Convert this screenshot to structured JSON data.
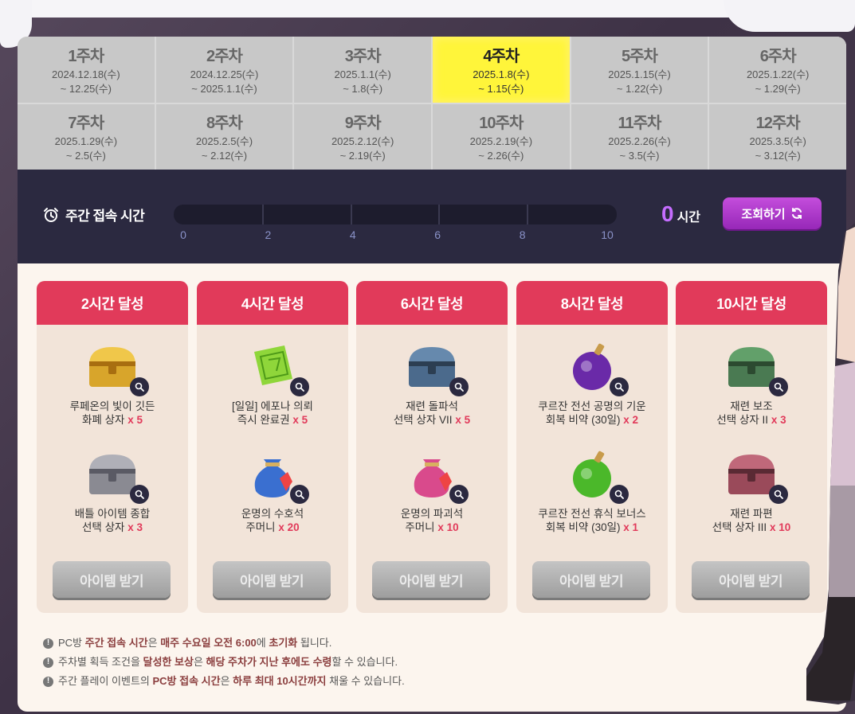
{
  "weeks": [
    {
      "title": "1주차",
      "start": "2024.12.18(수)",
      "end": "~ 12.25(수)"
    },
    {
      "title": "2주차",
      "start": "2024.12.25(수)",
      "end": "~ 2025.1.1(수)"
    },
    {
      "title": "3주차",
      "start": "2025.1.1(수)",
      "end": "~ 1.8(수)"
    },
    {
      "title": "4주차",
      "start": "2025.1.8(수)",
      "end": "~ 1.15(수)"
    },
    {
      "title": "5주차",
      "start": "2025.1.15(수)",
      "end": "~ 1.22(수)"
    },
    {
      "title": "6주차",
      "start": "2025.1.22(수)",
      "end": "~ 1.29(수)"
    },
    {
      "title": "7주차",
      "start": "2025.1.29(수)",
      "end": "~ 2.5(수)"
    },
    {
      "title": "8주차",
      "start": "2025.2.5(수)",
      "end": "~ 2.12(수)"
    },
    {
      "title": "9주차",
      "start": "2025.2.12(수)",
      "end": "~ 2.19(수)"
    },
    {
      "title": "10주차",
      "start": "2025.2.19(수)",
      "end": "~ 2.26(수)"
    },
    {
      "title": "11주차",
      "start": "2025.2.26(수)",
      "end": "~ 3.5(수)"
    },
    {
      "title": "12주차",
      "start": "2025.3.5(수)",
      "end": "~ 3.12(수)"
    }
  ],
  "active_week": 4,
  "timebar": {
    "label": "주간 접속 시간",
    "ticks": [
      "0",
      "2",
      "4",
      "6",
      "8",
      "10"
    ],
    "progress_hours": 0,
    "hours_value": "0",
    "hours_unit": "시간",
    "refresh_label": "조회하기"
  },
  "rewards": [
    {
      "title": "2시간 달성",
      "items": [
        {
          "icon": "golden-chest-icon",
          "name1": "루페온의 빛이 깃든",
          "name2": "화폐 상자",
          "qty": "x 5"
        },
        {
          "icon": "battle-item-chest-icon",
          "name1": "배틀 아이템 종합",
          "name2": "선택 상자",
          "qty": "x 3"
        }
      ],
      "button": "아이템 받기"
    },
    {
      "title": "4시간 달성",
      "items": [
        {
          "icon": "green-scroll-icon",
          "name1": "[일일] 에포나 의뢰",
          "name2": "즉시 완료권",
          "qty": "x 5"
        },
        {
          "icon": "blue-pouch-icon",
          "name1": "운명의 수호석",
          "name2": "주머니",
          "qty": "x 20"
        }
      ],
      "button": "아이템 받기"
    },
    {
      "title": "6시간 달성",
      "items": [
        {
          "icon": "blue-chest-icon",
          "name1": "재련 돌파석",
          "name2": "선택 상자 VII",
          "qty": "x 5"
        },
        {
          "icon": "pink-pouch-icon",
          "name1": "운명의 파괴석",
          "name2": "주머니",
          "qty": "x 10"
        }
      ],
      "button": "아이템 받기"
    },
    {
      "title": "8시간 달성",
      "items": [
        {
          "icon": "purple-potion-icon",
          "name1": "쿠르잔 전선 공명의 기운",
          "name2": "회복 비약 (30일)",
          "qty": "x 2"
        },
        {
          "icon": "green-potion-icon",
          "name1": "쿠르잔 전선 휴식 보너스",
          "name2": "회복 비약 (30일)",
          "qty": "x 1"
        }
      ],
      "button": "아이템 받기"
    },
    {
      "title": "10시간 달성",
      "items": [
        {
          "icon": "green-chest-icon",
          "name1": "재련 보조",
          "name2": "선택 상자 II",
          "qty": "x 3"
        },
        {
          "icon": "red-chest-icon",
          "name1": "재련 파편",
          "name2": "선택 상자 III",
          "qty": "x 10"
        }
      ],
      "button": "아이템 받기"
    }
  ],
  "notes": [
    {
      "a": "PC방 ",
      "b": "주간 접속 시간",
      "c": "은 ",
      "d": "매주 수요일 오전 6:00",
      "e": "에 ",
      "f": "초기화",
      "g": " 됩니다."
    },
    {
      "a": "주차별 획득 조건을 ",
      "b": "달성한 보상",
      "c": "은 ",
      "d": "해당 주차가 지난 후에도 수령",
      "e": "할 수 있습니다.",
      "f": "",
      "g": ""
    },
    {
      "a": "주간 플레이 이벤트의 ",
      "b": "PC방 접속 시간",
      "c": "은 ",
      "d": "하루 최대 10시간까지",
      "e": " 채울 수 있습니다.",
      "f": "",
      "g": ""
    }
  ],
  "colors": {
    "accent": "#e13a5a",
    "active_week": "#fff53a",
    "timebar_bg": "#2b2940",
    "refresh": "#b23acc"
  }
}
